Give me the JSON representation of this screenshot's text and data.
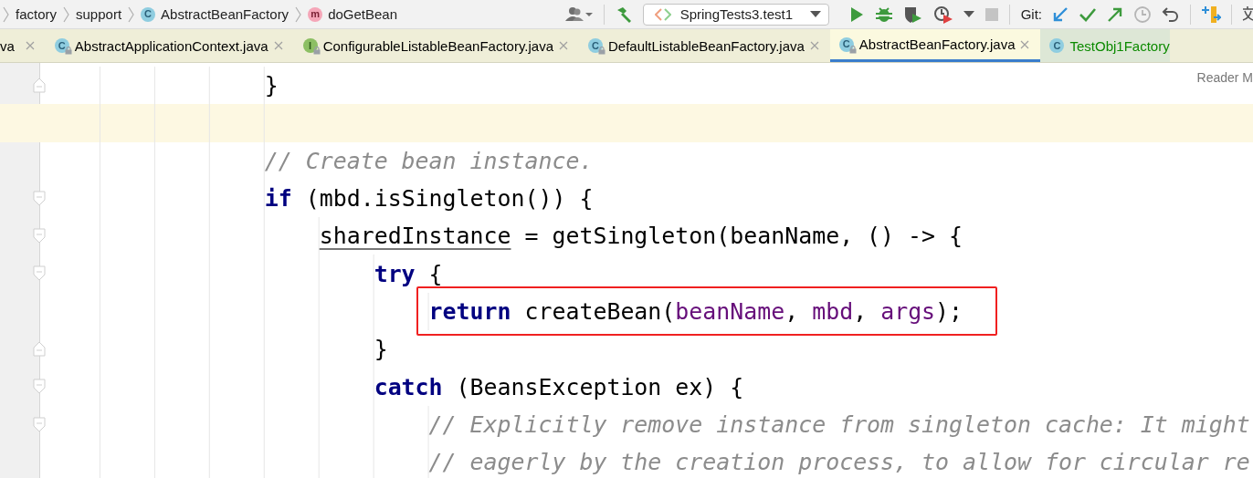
{
  "breadcrumbs": [
    {
      "label": "factory",
      "kind": "folder"
    },
    {
      "label": "support",
      "kind": "folder"
    },
    {
      "label": "AbstractBeanFactory",
      "kind": "class",
      "icon_letter": "C"
    },
    {
      "label": "doGetBean",
      "kind": "method",
      "icon_letter": "m"
    }
  ],
  "toolbar": {
    "run_configuration": "SpringTests3.test1",
    "git_label": "Git:"
  },
  "tabs": [
    {
      "label": "va",
      "kind": "plain",
      "locked": false,
      "closable": true,
      "selected": false,
      "color": "#000000"
    },
    {
      "label": "AbstractApplicationContext.java",
      "kind": "class",
      "icon_letter": "C",
      "locked": true,
      "closable": true,
      "selected": false,
      "color": "#000000"
    },
    {
      "label": "ConfigurableListableBeanFactory.java",
      "kind": "interface",
      "icon_letter": "I",
      "locked": true,
      "closable": true,
      "selected": false,
      "color": "#000000"
    },
    {
      "label": "DefaultListableBeanFactory.java",
      "kind": "class",
      "icon_letter": "C",
      "locked": true,
      "closable": true,
      "selected": false,
      "color": "#000000"
    },
    {
      "label": "AbstractBeanFactory.java",
      "kind": "class",
      "icon_letter": "C",
      "locked": true,
      "closable": true,
      "selected": true,
      "color": "#000000"
    },
    {
      "label": "TestObj1Factory",
      "kind": "class",
      "icon_letter": "C",
      "locked": false,
      "closable": false,
      "selected": false,
      "color": "#0b8a00"
    }
  ],
  "editor": {
    "reader_mode": "Reader M",
    "lines": [
      {
        "fold_start": false,
        "fold_end": true,
        "current": false,
        "boxed": false,
        "segments": [
          {
            "kind": "plain",
            "text": "}"
          }
        ]
      },
      {
        "fold_start": false,
        "fold_end": false,
        "current": true,
        "boxed": false
      },
      {
        "fold_start": false,
        "fold_end": false,
        "current": false,
        "boxed": false,
        "segments": [
          {
            "kind": "comment",
            "text": "// Create bean instance."
          }
        ]
      },
      {
        "fold_start": true,
        "fold_end": false,
        "current": false,
        "boxed": false,
        "segments": [
          {
            "kind": "keyword",
            "text": "if"
          },
          {
            "kind": "plain",
            "text": " (mbd.isSingleton()) {"
          }
        ],
        "children": [
          {
            "fold_start": true,
            "fold_end": false,
            "current": false,
            "boxed": false,
            "segments": [
              {
                "kind": "underlined",
                "text": "sharedInstance"
              },
              {
                "kind": "plain",
                "text": " = getSingleton(beanName, () -> {"
              }
            ],
            "children": [
              {
                "fold_start": true,
                "fold_end": false,
                "current": false,
                "boxed": false,
                "segments": [
                  {
                    "kind": "keyword",
                    "text": "try"
                  },
                  {
                    "kind": "plain",
                    "text": " {"
                  }
                ],
                "children": [
                  {
                    "fold_start": false,
                    "fold_end": false,
                    "current": false,
                    "boxed": true,
                    "segments": [
                      {
                        "kind": "keyword",
                        "text": "return"
                      },
                      {
                        "kind": "plain",
                        "text": " createBean("
                      },
                      {
                        "kind": "variable",
                        "text": "beanName"
                      },
                      {
                        "kind": "plain",
                        "text": ", "
                      },
                      {
                        "kind": "variable",
                        "text": "mbd"
                      },
                      {
                        "kind": "plain",
                        "text": ", "
                      },
                      {
                        "kind": "variable",
                        "text": "args"
                      },
                      {
                        "kind": "plain",
                        "text": ");"
                      }
                    ]
                  }
                ]
              },
              {
                "fold_start": false,
                "fold_end": true,
                "current": false,
                "boxed": false,
                "segments": [
                  {
                    "kind": "plain",
                    "text": "}"
                  }
                ]
              },
              {
                "fold_start": true,
                "fold_end": false,
                "current": false,
                "boxed": false,
                "segments": [
                  {
                    "kind": "keyword",
                    "text": "catch"
                  },
                  {
                    "kind": "plain",
                    "text": " (BeansException ex) {"
                  }
                ],
                "children": [
                  {
                    "fold_start": true,
                    "fold_end": false,
                    "current": false,
                    "boxed": false,
                    "segments": [
                      {
                        "kind": "comment",
                        "text": "// Explicitly remove instance from singleton cache: It might"
                      }
                    ]
                  },
                  {
                    "fold_start": false,
                    "fold_end": false,
                    "current": false,
                    "boxed": false,
                    "segments": [
                      {
                        "kind": "comment",
                        "text": "// eagerly by the creation process, to allow for circular re"
                      }
                    ]
                  }
                ]
              }
            ]
          }
        ]
      }
    ]
  }
}
